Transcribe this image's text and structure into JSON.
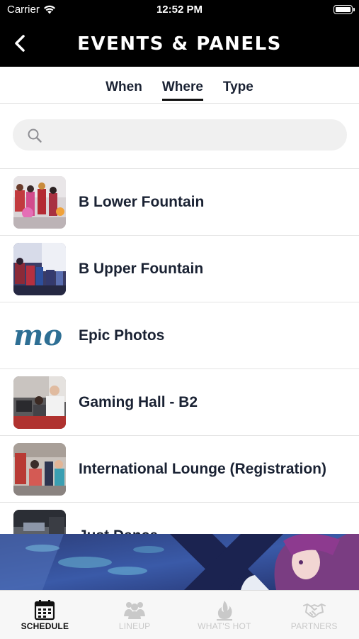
{
  "status_bar": {
    "carrier": "Carrier",
    "time": "12:52 PM"
  },
  "nav": {
    "title": "EVENTS & PANELS"
  },
  "tabs": [
    {
      "label": "When",
      "active": false
    },
    {
      "label": "Where",
      "active": true
    },
    {
      "label": "Type",
      "active": false
    }
  ],
  "search": {
    "placeholder": ""
  },
  "locations": [
    {
      "label": "B Lower Fountain"
    },
    {
      "label": "B Upper Fountain"
    },
    {
      "label": "Epic Photos",
      "logo_text": "mo"
    },
    {
      "label": "Gaming Hall - B2"
    },
    {
      "label": "International Lounge (Registration)"
    },
    {
      "label": "Just Dance"
    }
  ],
  "tab_bar": [
    {
      "label": "SCHEDULE",
      "icon": "calendar-icon",
      "active": true
    },
    {
      "label": "LINEUP",
      "icon": "people-icon",
      "active": false
    },
    {
      "label": "WHAT'S HOT",
      "icon": "flame-icon",
      "active": false
    },
    {
      "label": "PARTNERS",
      "icon": "handshake-icon",
      "active": false
    }
  ],
  "colors": {
    "nav_bg": "#000000",
    "text_dark": "#1a2233",
    "tab_inactive": "#c9c9c9",
    "epic_logo": "#2e6f94"
  }
}
